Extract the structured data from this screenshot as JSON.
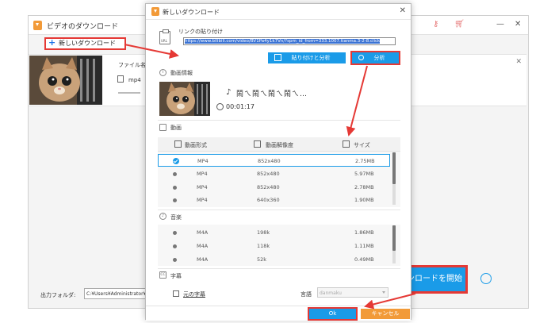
{
  "colors": {
    "accent_blue": "#1a9be8",
    "highlight_red": "#e53935",
    "cancel_orange": "#f29a38"
  },
  "main_window": {
    "title": "ビデオのダウンロード",
    "new_download_label": "新しいダウンロード",
    "file_name_label": "ファイル名:",
    "format": "mp4",
    "output_folder_label": "出力フォルダ:",
    "output_path": "C:¥Users¥Administrator¥Vid",
    "start_download_label": "ダウンロードを開始",
    "icons": [
      "key-icon",
      "cart-icon",
      "minimize-icon",
      "close-icon",
      "alarm-icon"
    ]
  },
  "dialog": {
    "title": "新しいダウンロード",
    "link_paste_label": "リンクの貼り付け",
    "url": "https://www.bilibili.com/video/BV1Pa4y1k7Vn/?spm_id_from=333.1007.tianma.3-2-8.click",
    "paste_and_analyze_label": "貼り付けと分析",
    "analyze_label": "分析",
    "video_info_label": "動画情報",
    "video_title": "鬧ㄟ鬧ㄟ鬧ㄟ鬧ㄟ…",
    "duration": "00:01:17",
    "video_section_label": "動画",
    "video_columns": [
      "動画形式",
      "動画解像度",
      "サイズ"
    ],
    "video_rows": [
      {
        "format": "MP4",
        "resolution": "852x480",
        "size": "2.75MB",
        "selected": true
      },
      {
        "format": "MP4",
        "resolution": "852x480",
        "size": "5.97MB",
        "selected": false
      },
      {
        "format": "MP4",
        "resolution": "852x480",
        "size": "2.78MB",
        "selected": false
      },
      {
        "format": "MP4",
        "resolution": "640x360",
        "size": "1.90MB",
        "selected": false
      }
    ],
    "audio_section_label": "音楽",
    "audio_rows": [
      {
        "format": "M4A",
        "bitrate": "198k",
        "size": "1.86MB"
      },
      {
        "format": "M4A",
        "bitrate": "118k",
        "size": "1.11MB"
      },
      {
        "format": "M4A",
        "bitrate": "52k",
        "size": "0.49MB"
      }
    ],
    "subtitle_section_label": "字幕",
    "original_subtitle_label": "元の字幕",
    "language_label": "言語",
    "language_value": "danmaku",
    "ok_label": "Ok",
    "cancel_label": "キャンセル"
  }
}
